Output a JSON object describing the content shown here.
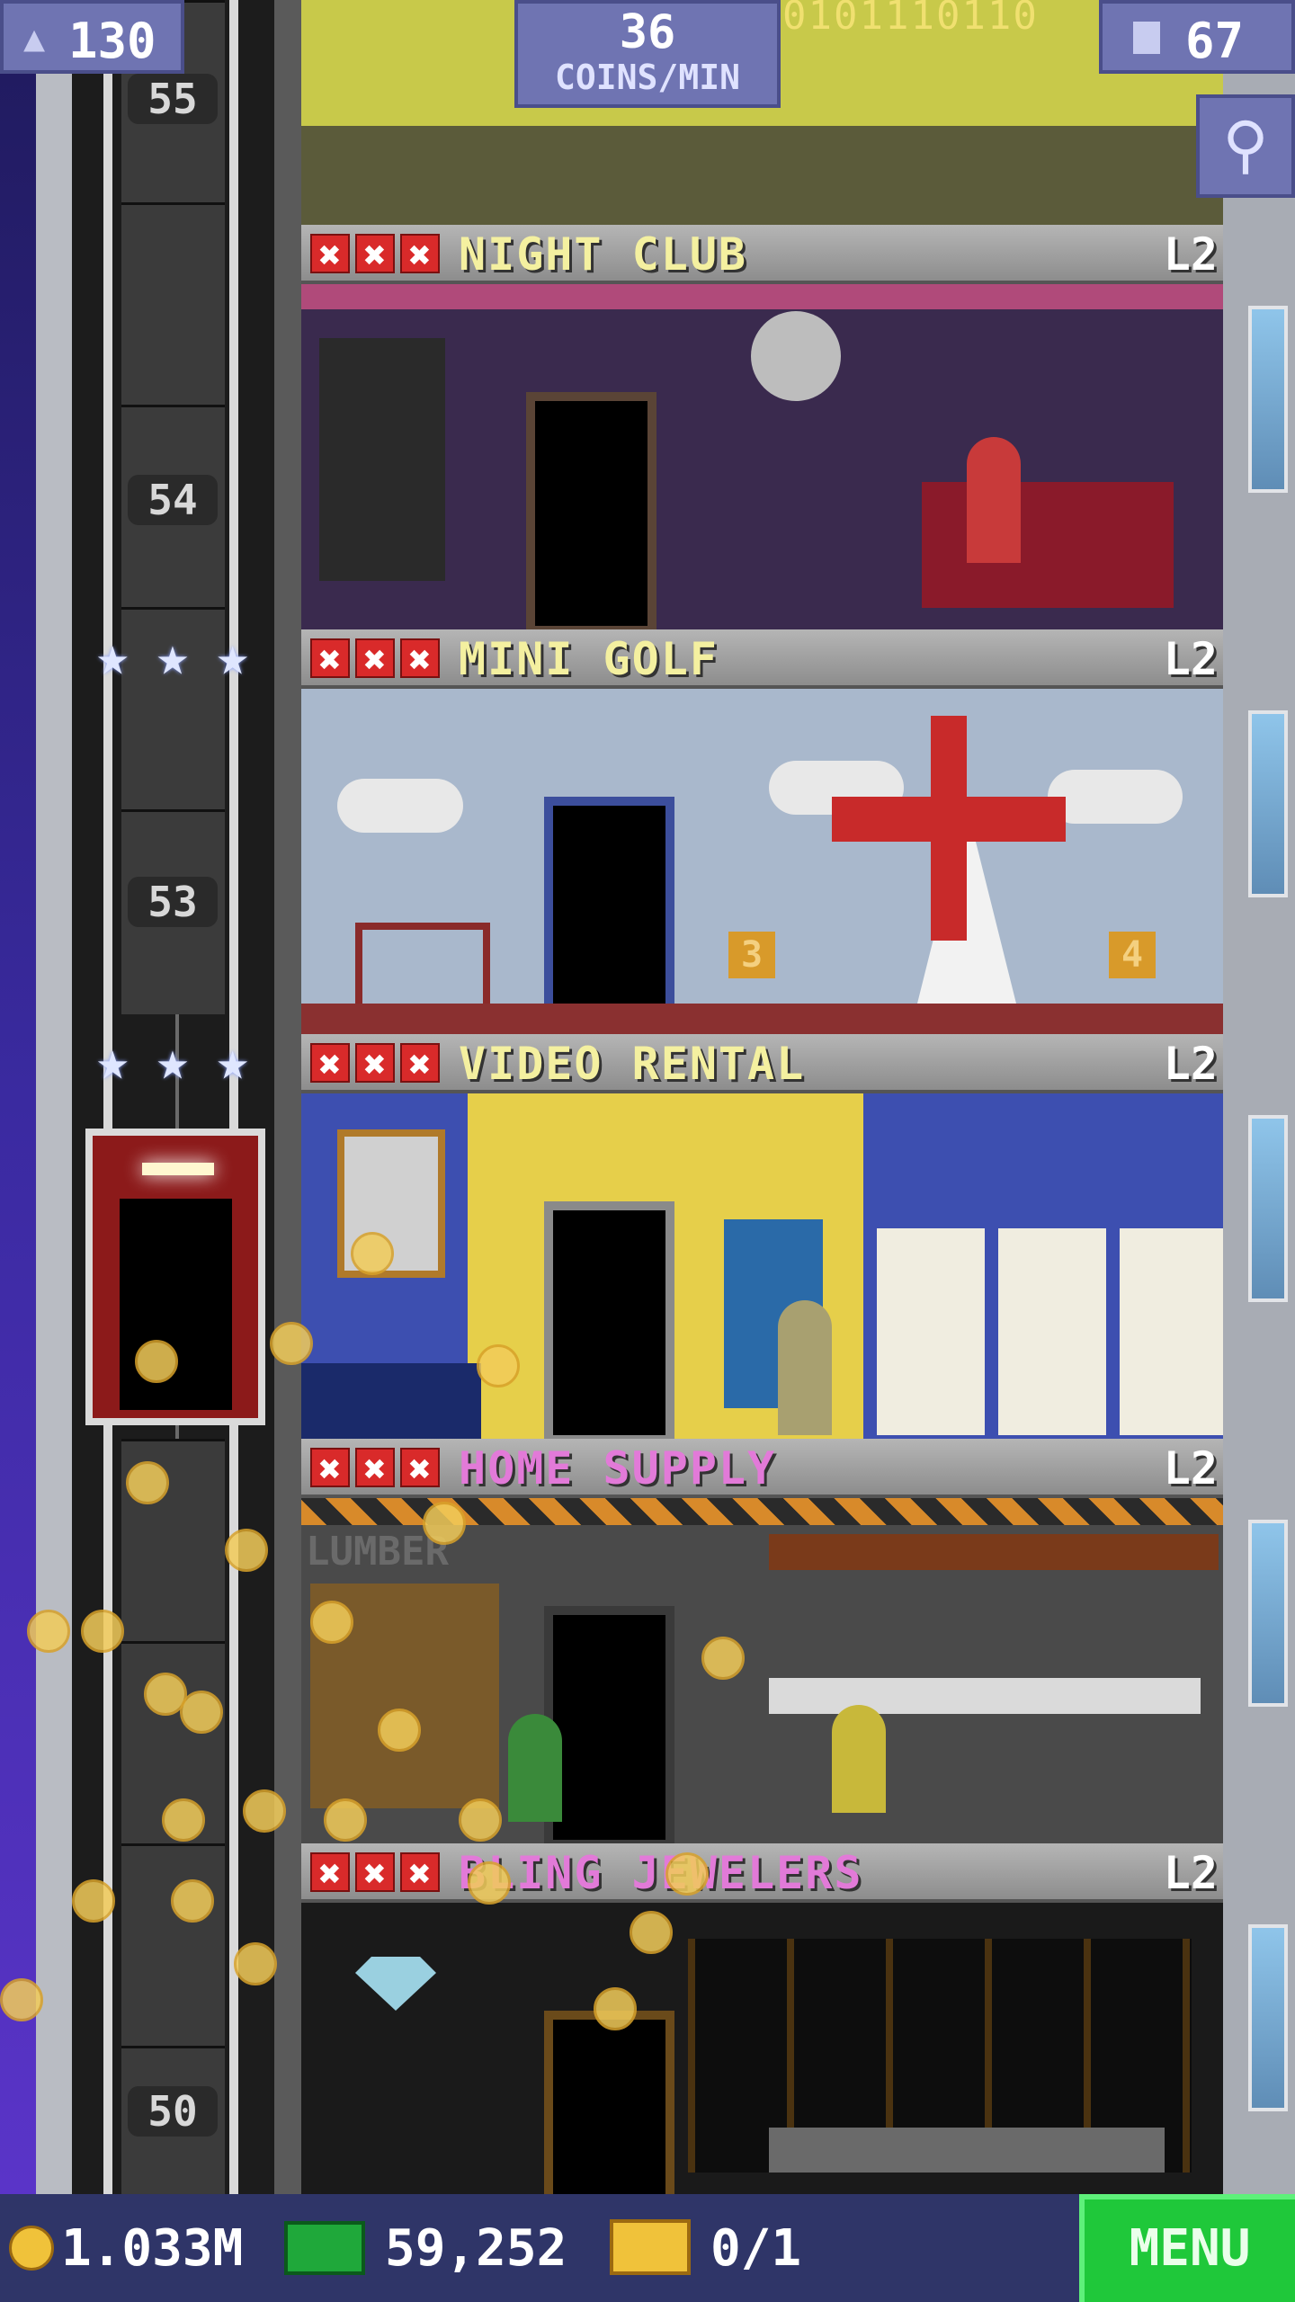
{
  "header": {
    "population": "130",
    "coins_per_min_value": "36",
    "coins_per_min_label": "COINS/MIN",
    "floor_count": "67",
    "binary_text": "0101110110"
  },
  "shaft": {
    "floor_numbers": [
      "55",
      "54",
      "53",
      "50"
    ],
    "stars_row1": [
      "★",
      "★",
      "★"
    ],
    "stars_row2": [
      "★",
      "★",
      "★"
    ]
  },
  "floors": [
    {
      "name": "NIGHT CLUB",
      "level": "L2",
      "name_color": "#f4f0a0"
    },
    {
      "name": "MINI GOLF",
      "level": "L2",
      "name_color": "#f4f0a0"
    },
    {
      "name": "VIDEO RENTAL",
      "level": "L2",
      "name_color": "#f4f0a0"
    },
    {
      "name": "HOME SUPPLY",
      "level": "L2",
      "name_color": "#e27ad8"
    },
    {
      "name": "BLING JEWELERS",
      "level": "L2",
      "name_color": "#e27ad8"
    }
  ],
  "room_labels": {
    "golf_hole_3": "3",
    "golf_hole_4": "4",
    "lumber_sign": "LUMBER"
  },
  "icons": {
    "x_mark": "✖",
    "population": "person-icon",
    "floors": "building-icon",
    "search": "⚲"
  },
  "footer": {
    "coins": "1.033M",
    "bux": "59,252",
    "tickets": "0/1",
    "menu_label": "MENU"
  },
  "colors": {
    "header_box": "#6f74b2",
    "menu_green": "#1fc83a",
    "x_red": "#d92a2a",
    "coin_gold": "#f0c23a"
  }
}
